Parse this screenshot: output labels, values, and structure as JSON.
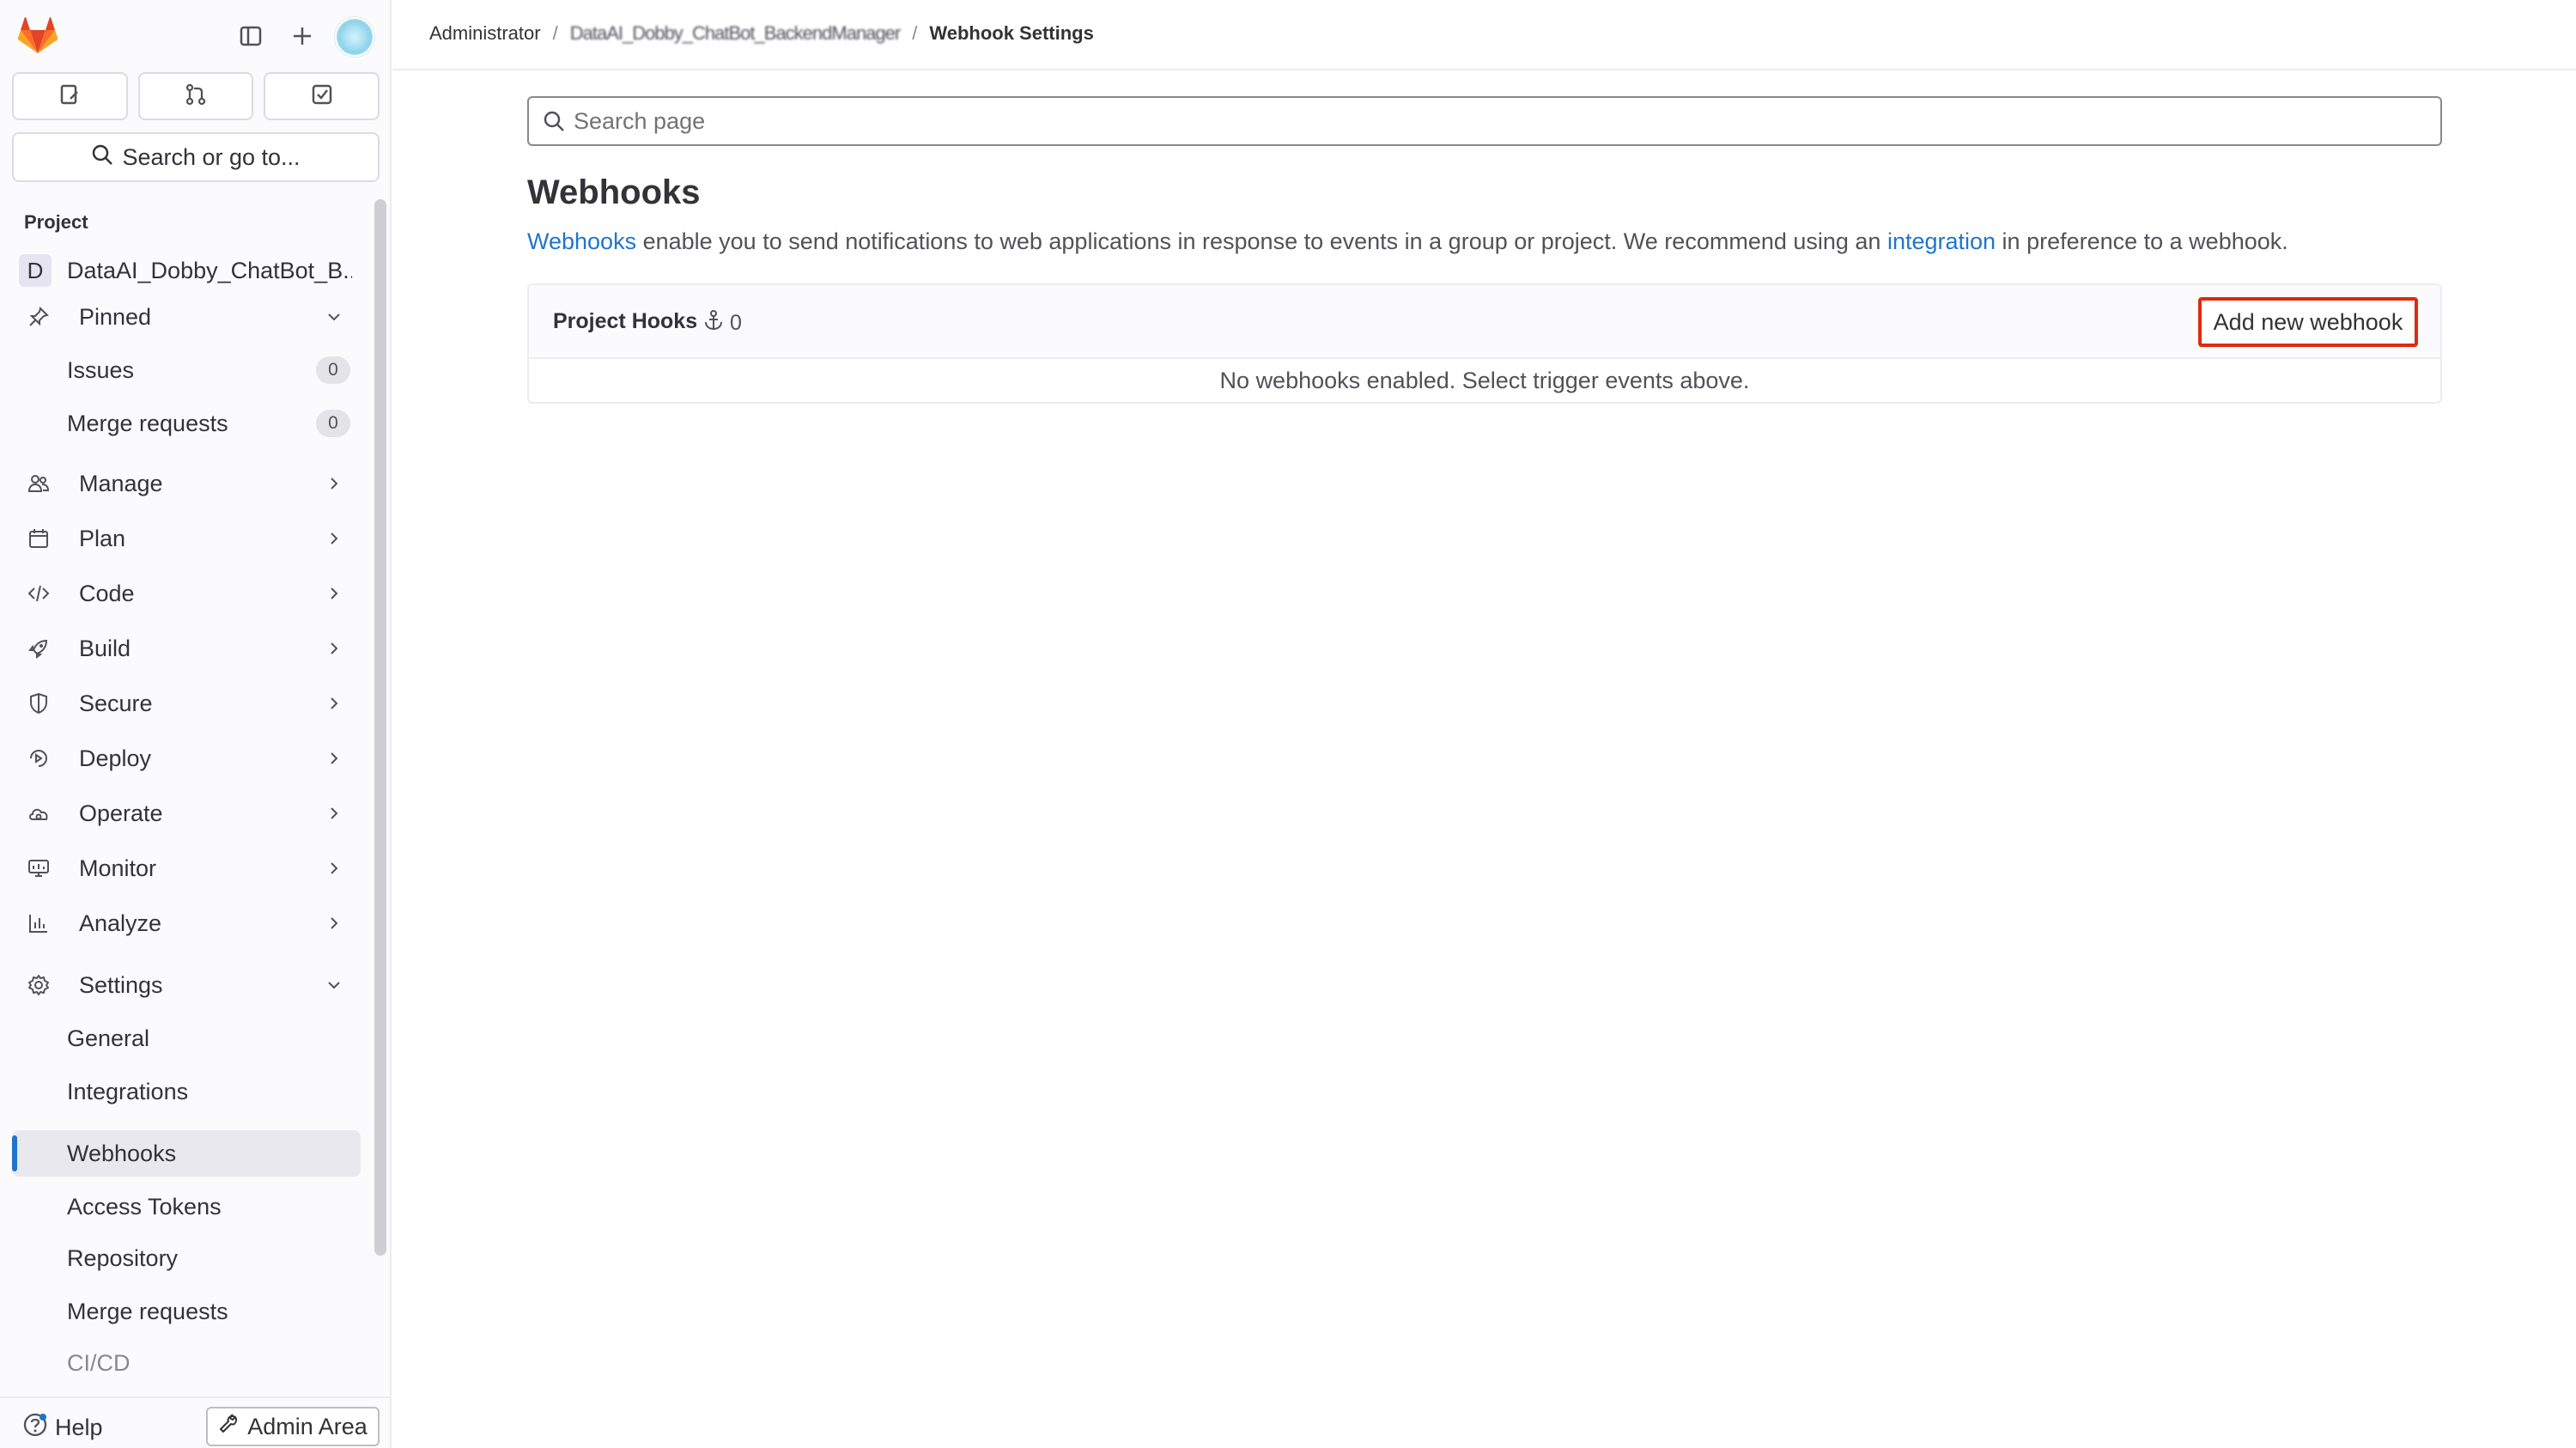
{
  "sidebar": {
    "search_label": "Search or go to...",
    "project_heading": "Project",
    "project_initial": "D",
    "project_name": "DataAI_Dobby_ChatBot_B...",
    "pinned": {
      "label": "Pinned",
      "items": [
        {
          "label": "Issues",
          "count": "0"
        },
        {
          "label": "Merge requests",
          "count": "0"
        }
      ]
    },
    "sections": [
      {
        "label": "Manage",
        "icon": "users-icon"
      },
      {
        "label": "Plan",
        "icon": "calendar-icon"
      },
      {
        "label": "Code",
        "icon": "code-icon"
      },
      {
        "label": "Build",
        "icon": "rocket-icon"
      },
      {
        "label": "Secure",
        "icon": "shield-icon"
      },
      {
        "label": "Deploy",
        "icon": "deploy-icon"
      },
      {
        "label": "Operate",
        "icon": "cloud-gear-icon"
      },
      {
        "label": "Monitor",
        "icon": "monitor-icon"
      },
      {
        "label": "Analyze",
        "icon": "chart-icon"
      }
    ],
    "settings": {
      "label": "Settings",
      "items": [
        {
          "label": "General"
        },
        {
          "label": "Integrations"
        },
        {
          "label": "Webhooks",
          "active": true
        },
        {
          "label": "Access Tokens"
        },
        {
          "label": "Repository"
        },
        {
          "label": "Merge requests"
        },
        {
          "label": "CI/CD"
        }
      ]
    },
    "help_label": "Help",
    "admin_label": "Admin Area"
  },
  "breadcrumb": {
    "root": "Administrator",
    "project": "DataAI_Dobby_ChatBot_BackendManager",
    "current": "Webhook Settings"
  },
  "search": {
    "placeholder": "Search page",
    "value": ""
  },
  "main": {
    "title": "Webhooks",
    "intro_link1": "Webhooks",
    "intro_text1": " enable you to send notifications to web applications in response to events in a group or project. We recommend using an ",
    "intro_link2": "integration",
    "intro_text2": " in preference to a webhook.",
    "hooks_title": "Project Hooks",
    "hooks_count": "0",
    "add_button": "Add new webhook",
    "empty_message": "No webhooks enabled. Select trigger events above."
  },
  "colors": {
    "accent": "#1f75cb",
    "highlight": "#dd2b0e",
    "logo": "#e24329"
  }
}
